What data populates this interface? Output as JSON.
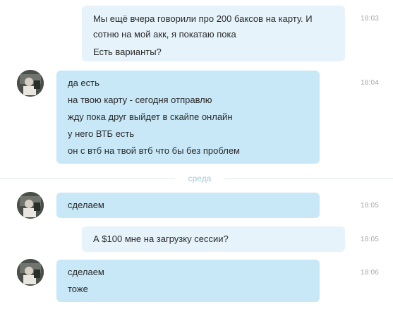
{
  "messages": [
    {
      "direction": "out",
      "time": "18:03",
      "lines": [
        "Мы ещё вчера говорили про 200 баксов на карту. И сотню на мой акк, я покатаю пока",
        "Есть варианты?"
      ]
    },
    {
      "direction": "in",
      "time": "18:04",
      "lines": [
        "да есть",
        "на твою карту - сегодня отправлю",
        "жду пока друг выйдет в скайпе онлайн",
        "у него ВТБ есть",
        "он с втб на твой втб что бы без проблем"
      ]
    },
    {
      "direction": "in",
      "time": "18:05",
      "lines": [
        "сделаем"
      ]
    },
    {
      "direction": "out",
      "time": "18:05",
      "lines": [
        "А $100 мне на загрузку сессии?"
      ]
    },
    {
      "direction": "in",
      "time": "18:06",
      "lines": [
        "сделаем",
        "тоже"
      ]
    }
  ],
  "day_divider": "среда",
  "colors": {
    "outgoing_bubble": "#e6f3fb",
    "incoming_bubble": "#c8e8f8",
    "timestamp": "#a8a8a8",
    "divider_label": "#a9c6d8"
  },
  "icons": {
    "contact_avatar": "user-photo-avatar"
  }
}
